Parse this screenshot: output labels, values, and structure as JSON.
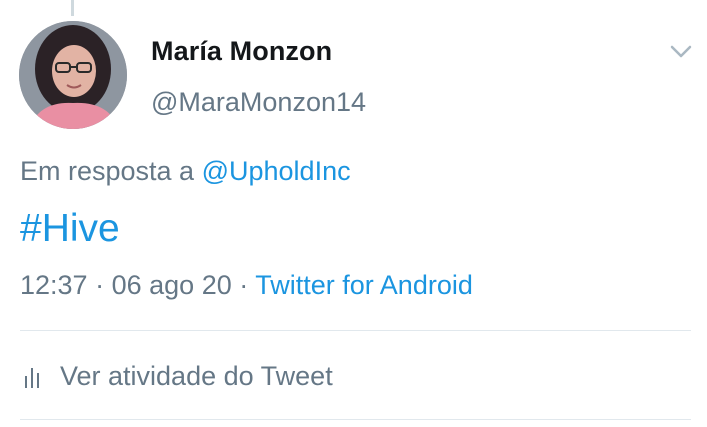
{
  "tweet": {
    "author": {
      "name": "María Monzon",
      "handle": "@MaraMonzon14"
    },
    "reply_prefix": "Em resposta a",
    "reply_to": "@UpholdInc",
    "text": "#Hive",
    "time": "12:37",
    "separator": "·",
    "date": "06 ago 20",
    "source": "Twitter for Android",
    "activity_label": "Ver atividade do Tweet"
  },
  "icons": {
    "menu": "chevron-down-icon",
    "activity": "bar-chart-icon"
  },
  "colors": {
    "link": "#1b95e0",
    "secondary_text": "#657786",
    "primary_text": "#14171a",
    "divider": "#e1e8ed"
  }
}
